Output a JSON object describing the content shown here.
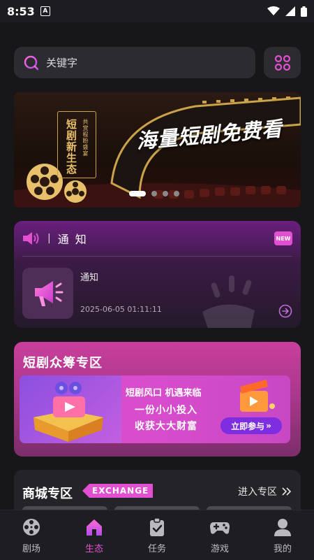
{
  "status_bar": {
    "time": "8:53",
    "app_letter": "A"
  },
  "search": {
    "placeholder": "关键字"
  },
  "banner": {
    "headline": "海量短剧免费看",
    "tag_main": "短剧新生态",
    "tag_sub": "共赏程盼盛宴",
    "dots": 4,
    "active_dot": 0
  },
  "notice": {
    "title": "通 知",
    "badge": "NEW",
    "message": "通知",
    "time": "2025-06-05 01:11:11"
  },
  "crowdfunding": {
    "title": "短剧众筹专区",
    "line1": "短剧风口 机遇来临",
    "line2": "一份小小投入",
    "line3": "收获大大财富",
    "join_label": "立即参与"
  },
  "mall": {
    "title": "商城专区",
    "tag": "EXCHANGE",
    "more_label": "进入专区"
  },
  "tabbar": {
    "tabs": [
      {
        "label": "剧场",
        "icon": "film-reel-icon",
        "active": false
      },
      {
        "label": "生态",
        "icon": "home-icon",
        "active": true
      },
      {
        "label": "任务",
        "icon": "clipboard-check-icon",
        "active": false
      },
      {
        "label": "游戏",
        "icon": "gamepad-icon",
        "active": false
      },
      {
        "label": "我的",
        "icon": "user-icon",
        "active": false
      }
    ]
  },
  "colors": {
    "accent": "#e24fd1",
    "background": "#17171a",
    "card": "#2b2b30"
  }
}
